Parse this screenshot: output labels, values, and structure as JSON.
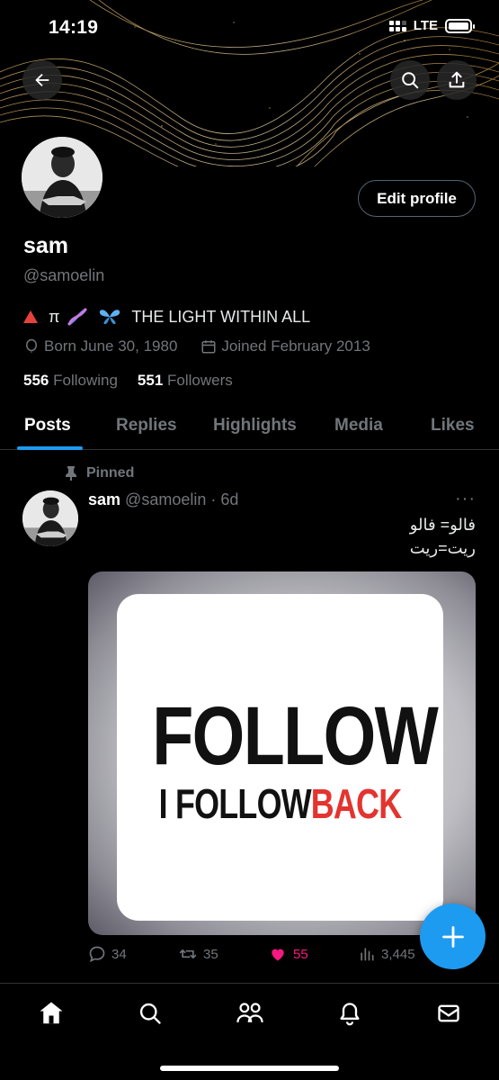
{
  "status_bar": {
    "time": "14:19",
    "network": "LTE"
  },
  "profile": {
    "display_name": "sam",
    "handle": "@samoelin",
    "bio": "THE LIGHT WITHIN ALL",
    "bio_pi": "π",
    "born": "Born June 30, 1980",
    "joined": "Joined February 2013",
    "following_count": "556",
    "following_label": "Following",
    "followers_count": "551",
    "followers_label": "Followers",
    "edit_profile_label": "Edit profile"
  },
  "tabs": [
    {
      "label": "Posts",
      "active": true
    },
    {
      "label": "Replies"
    },
    {
      "label": "Highlights"
    },
    {
      "label": "Media"
    },
    {
      "label": "Likes"
    }
  ],
  "post": {
    "pinned_label": "Pinned",
    "author": "sam",
    "handle": "@samoelin",
    "time": "· 6d",
    "more": "···",
    "text_line1": "فالو= فالو",
    "text_line2": "ريت=ريت",
    "media_text_big": "FOLLOW",
    "media_text_small_dark": "I FOLLOW",
    "media_text_small_red": "BACK",
    "replies": "34",
    "reposts": "35",
    "likes": "55",
    "views": "3,445"
  },
  "colors": {
    "accent": "#1d9bf0",
    "like": "#f91880",
    "muted": "#71767b"
  },
  "icons": [
    "back-arrow-icon",
    "search-icon",
    "share-icon",
    "location-icon",
    "calendar-icon",
    "pin-icon",
    "reply-icon",
    "repost-icon",
    "heart-icon",
    "views-icon",
    "plus-icon",
    "home-icon",
    "communities-icon",
    "bell-icon",
    "mail-icon"
  ]
}
